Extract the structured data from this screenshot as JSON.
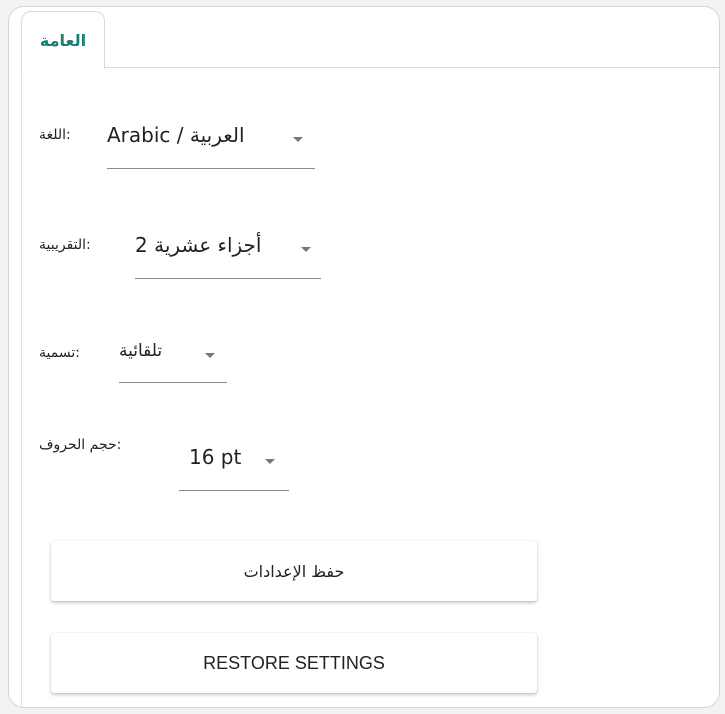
{
  "tabs": [
    {
      "label": "العامة",
      "active": true
    }
  ],
  "accent_color": "#1a7f73",
  "fields": {
    "language": {
      "label": ":اللغة",
      "value": "Arabic / العربية"
    },
    "rounding": {
      "label": ":التقريبية",
      "value": "أجزاء عشرية 2"
    },
    "naming": {
      "label": ":تسمية",
      "value": "تلقائية"
    },
    "font_size": {
      "label": ":حجم الحروف",
      "value": "16 pt"
    }
  },
  "buttons": {
    "save_label": "حفظ الإعدادات",
    "restore_label": "RESTORE SETTINGS"
  },
  "icons": {
    "dropdown": "chevron-down-icon"
  }
}
